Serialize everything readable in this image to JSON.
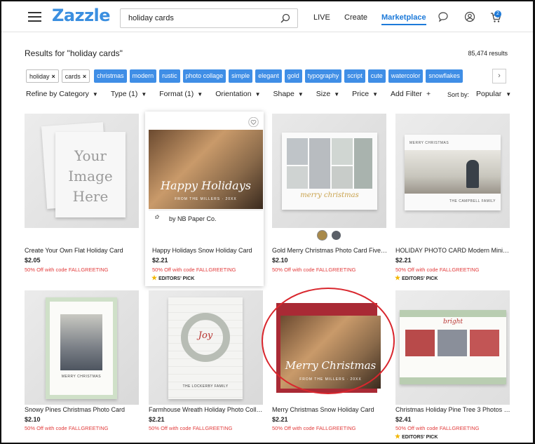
{
  "header": {
    "logo": "Zazzle",
    "search_value": "holiday cards",
    "nav": [
      "LIVE",
      "Create",
      "Marketplace"
    ],
    "cart_count": "2"
  },
  "results": {
    "title": "Results for \"holiday cards\"",
    "count": "85,474 results"
  },
  "applied_chips": [
    "holiday",
    "cards"
  ],
  "suggest_chips": [
    "christmas",
    "modern",
    "rustic",
    "photo collage",
    "simple",
    "elegant",
    "gold",
    "typography",
    "script",
    "cute",
    "watercolor",
    "snowflakes"
  ],
  "filters": [
    "Refine by Category",
    "Type (1)",
    "Format (1)",
    "Orientation",
    "Shape",
    "Size",
    "Price",
    "Add Filter"
  ],
  "sort": {
    "label": "Sort by:",
    "value": "Popular"
  },
  "thumb_text": {
    "your_image": [
      "Your",
      "Image",
      "Here"
    ],
    "happy": "Happy Holidays",
    "happy_sub": "FROM THE MILLERS · 20XX",
    "gold_merry": "merry christmas",
    "holiday_photo": "MERRY CHRISTMAS",
    "family": "THE CAMPBELL FAMILY",
    "joy": "Joy",
    "merry_christmas": "Merry Christmas",
    "merry_sub": "FROM THE MILLERS · 20XX",
    "bright": "bright",
    "wreath_family": "THE LOCKERBY FAMILY"
  },
  "products": [
    {
      "title": "Create Your Own Flat Holiday Card",
      "price": "$2.05",
      "promo": "50% Off with code FALLGREETING",
      "pick": ""
    },
    {
      "title": "Happy Holidays Snow Holiday Card",
      "price": "$2.21",
      "promo": "50% Off with code FALLGREETING",
      "pick": "EDITORS' PICK",
      "seller": "by NB Paper Co."
    },
    {
      "title": "Gold Merry Christmas Photo Card Five P...",
      "price": "$2.10",
      "promo": "50% Off with code FALLGREETING",
      "pick": ""
    },
    {
      "title": "HOLIDAY PHOTO CARD Modern Minimal...",
      "price": "$2.21",
      "promo": "50% Off with code FALLGREETING",
      "pick": "EDITORS' PICK"
    },
    {
      "title": "Snowy Pines Christmas Photo Card",
      "price": "$2.10",
      "promo": "50% Off with code FALLGREETING",
      "pick": ""
    },
    {
      "title": "Farmhouse Wreath Holiday Photo Collag...",
      "price": "$2.21",
      "promo": "50% Off with code FALLGREETING",
      "pick": ""
    },
    {
      "title": "Merry Christmas Snow Holiday Card",
      "price": "$2.21",
      "promo": "50% Off with code FALLGREETING",
      "pick": ""
    },
    {
      "title": "Christmas Holiday Pine Tree 3 Photos C...",
      "price": "$2.41",
      "promo": "50% Off with code FALLGREETING",
      "pick": "EDITORS' PICK"
    }
  ],
  "colors": {
    "accent": "#1d7ad9",
    "chip": "#3f8ee6",
    "promo": "#e23b3b",
    "highlight_circle": "#d9272e"
  },
  "swatches": [
    "#a8894a",
    "#5b6068"
  ]
}
